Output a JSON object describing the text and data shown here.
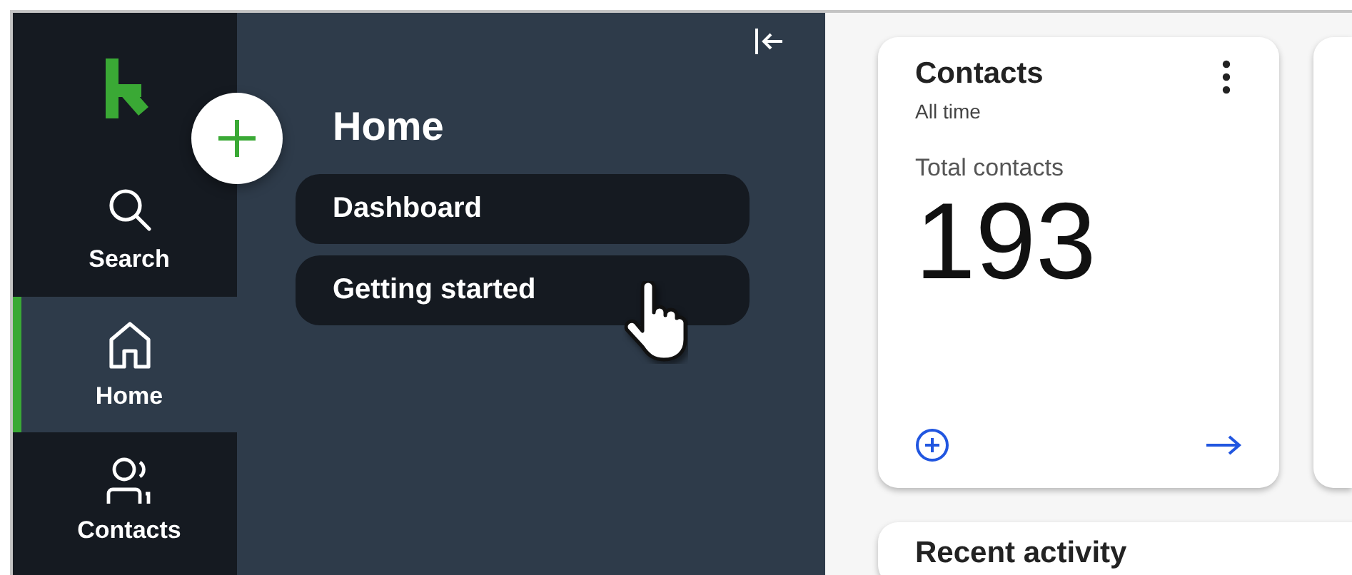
{
  "rail": {
    "items": [
      {
        "label": "Search",
        "kind": "search",
        "selected": false
      },
      {
        "label": "Home",
        "kind": "home",
        "selected": true
      },
      {
        "label": "Contacts",
        "kind": "contacts",
        "selected": false
      }
    ]
  },
  "panel": {
    "title": "Home",
    "items": [
      {
        "label": "Dashboard"
      },
      {
        "label": "Getting started"
      }
    ]
  },
  "cards": [
    {
      "title": "Contacts",
      "subtitle": "All time",
      "metric_label": "Total contacts",
      "value": "193"
    }
  ],
  "recent_activity": {
    "title": "Recent activity"
  }
}
